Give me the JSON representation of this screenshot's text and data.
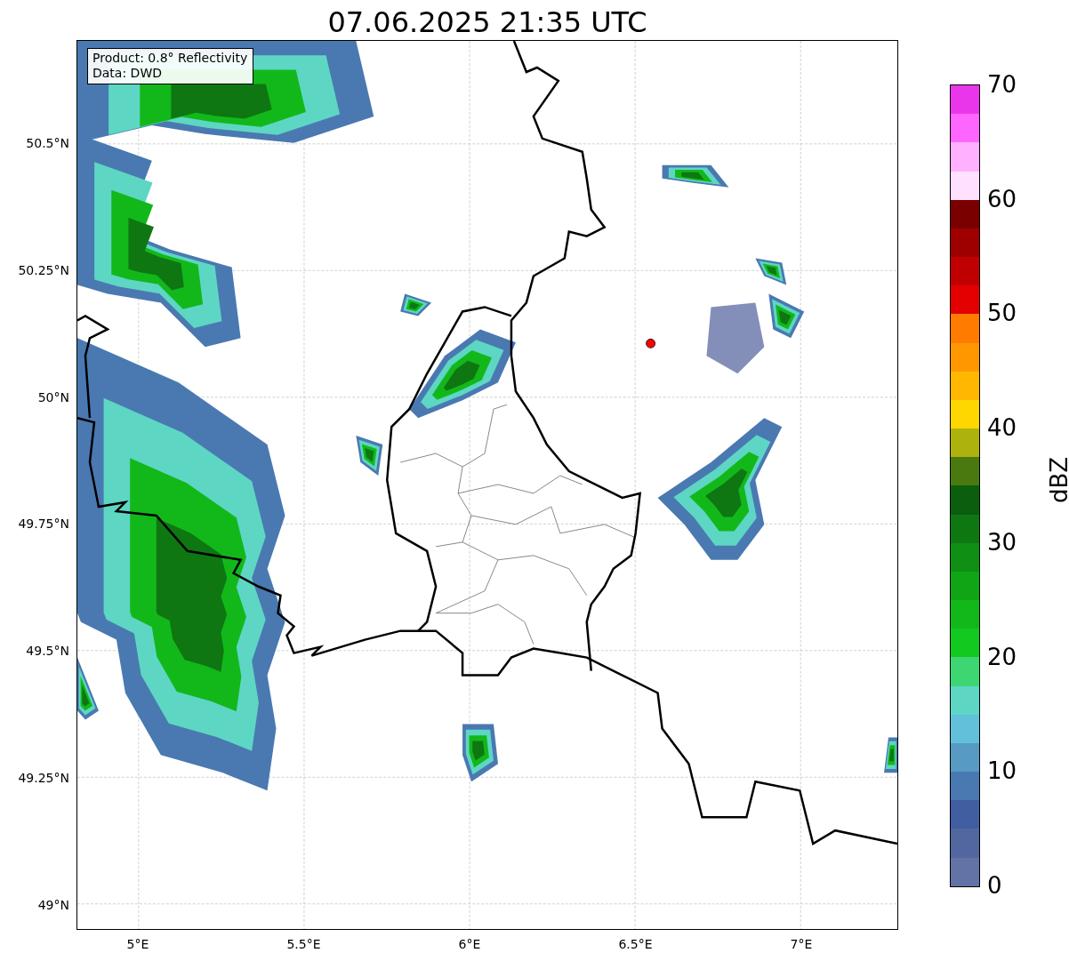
{
  "title": "07.06.2025 21:35 UTC",
  "map": {
    "info_lines": [
      "Product: 0.8° Reflectivity",
      "Data: DWD"
    ],
    "lat_ticks": [
      "50.5°N",
      "50.25°N",
      "50°N",
      "49.75°N",
      "49.5°N",
      "49.25°N",
      "49°N"
    ],
    "lon_ticks": [
      "5°E",
      "5.5°E",
      "6°E",
      "6.5°E",
      "7°E"
    ]
  },
  "colorbar": {
    "label": "dBZ",
    "ticks": [
      "70",
      "60",
      "50",
      "40",
      "30",
      "20",
      "10",
      "0"
    ],
    "bands": [
      {
        "color": "#ea36ea"
      },
      {
        "color": "#ff66ff"
      },
      {
        "color": "#ffb1ff"
      },
      {
        "color": "#ffe0ff"
      },
      {
        "color": "#7a0000"
      },
      {
        "color": "#9e0000"
      },
      {
        "color": "#c00000"
      },
      {
        "color": "#e40000"
      },
      {
        "color": "#ff7c00"
      },
      {
        "color": "#ff9800"
      },
      {
        "color": "#ffb700"
      },
      {
        "color": "#ffd700"
      },
      {
        "color": "#aeb20c"
      },
      {
        "color": "#4a7a0f"
      },
      {
        "color": "#0a5e0e"
      },
      {
        "color": "#0e7712"
      },
      {
        "color": "#0f8f14"
      },
      {
        "color": "#10a514"
      },
      {
        "color": "#12b81a"
      },
      {
        "color": "#12c91f"
      },
      {
        "color": "#3dd673"
      },
      {
        "color": "#5ed6c4"
      },
      {
        "color": "#62c0da"
      },
      {
        "color": "#579bc4"
      },
      {
        "color": "#4a79b1"
      },
      {
        "color": "#415ea1"
      },
      {
        "color": "#52679f"
      },
      {
        "color": "#6473a6"
      }
    ]
  }
}
